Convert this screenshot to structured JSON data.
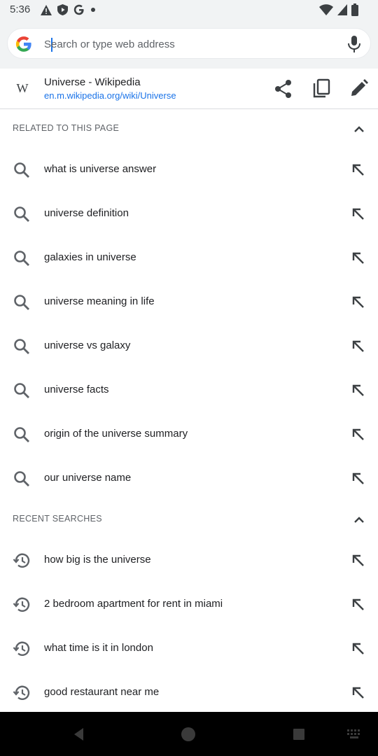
{
  "status_bar": {
    "time": "5:36",
    "left_icons": [
      "alert-triangle-icon",
      "shield-play-icon",
      "google-g-icon",
      "dot-icon"
    ],
    "right_icons": [
      "wifi-icon",
      "cell-signal-icon",
      "battery-icon"
    ]
  },
  "omnibox": {
    "placeholder": "Search or type web address",
    "value": "",
    "left_icon": "google-g-icon",
    "right_icon": "microphone-icon"
  },
  "current_page": {
    "icon": "wikipedia-icon",
    "icon_glyph": "W",
    "title": "Universe - Wikipedia",
    "url": "en.m.wikipedia.org/wiki/Universe",
    "actions": [
      "share-icon",
      "copy-icon",
      "edit-icon"
    ]
  },
  "related": {
    "header": "RELATED TO THIS PAGE",
    "items": [
      "what is universe answer",
      "universe definition",
      "galaxies in universe",
      "universe meaning in life",
      "universe vs galaxy",
      "universe facts",
      "origin of the universe summary",
      "our universe name"
    ]
  },
  "recent": {
    "header": "RECENT SEARCHES",
    "items": [
      "how big is the universe",
      "2 bedroom apartment for rent in miami",
      "what time is it in london",
      "good restaurant near me"
    ]
  },
  "nav_bar": {
    "icons": [
      "back-icon",
      "home-icon",
      "recents-icon",
      "keyboard-icon"
    ]
  },
  "colors": {
    "accent": "#1a73e8",
    "toolbar_bg": "#f1f3f4",
    "text": "#202124",
    "secondary_text": "#5f6368"
  }
}
